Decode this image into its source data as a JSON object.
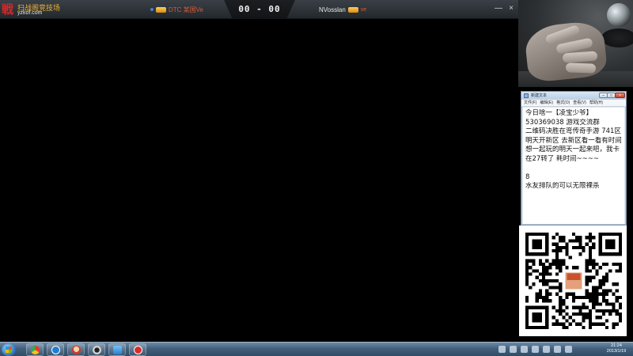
{
  "topbar": {
    "logo_cn": "扫战阁竞技场",
    "logo_domain": "yzkof.com",
    "player_left": {
      "name": "DTC 某国Ve"
    },
    "score": "00 - 00",
    "player_right": {
      "name": "NVosslan",
      "tag": "ve"
    },
    "win_min": "—",
    "win_close": "×"
  },
  "notepad": {
    "title": "新建文本",
    "btn_min": "–",
    "btn_max": "□",
    "btn_close": "×",
    "menus": [
      "文件(F)",
      "编辑(E)",
      "格式(O)",
      "查看(V)",
      "帮助(H)"
    ],
    "lines": [
      "今日啥一【凌宝少爷】",
      "530369038 游戏交流群",
      "二维码决胜在弯传奇手游 741区",
      "明天开新区 去新区看一看有时间",
      "想一起玩的明天一起来吧，我卡",
      "在27转了 耗时间~~~~",
      "",
      "8",
      "水友排队的可以无限裸杀"
    ]
  },
  "taskbar": {
    "clock_time": "21:24",
    "clock_date": "2013/1/19"
  },
  "icons": {
    "start": "windows-start-icon",
    "apps": [
      "chrome-icon",
      "kugou-icon",
      "game-avatar-icon",
      "obs-icon",
      "explorer-icon",
      "game-app-icon"
    ]
  }
}
